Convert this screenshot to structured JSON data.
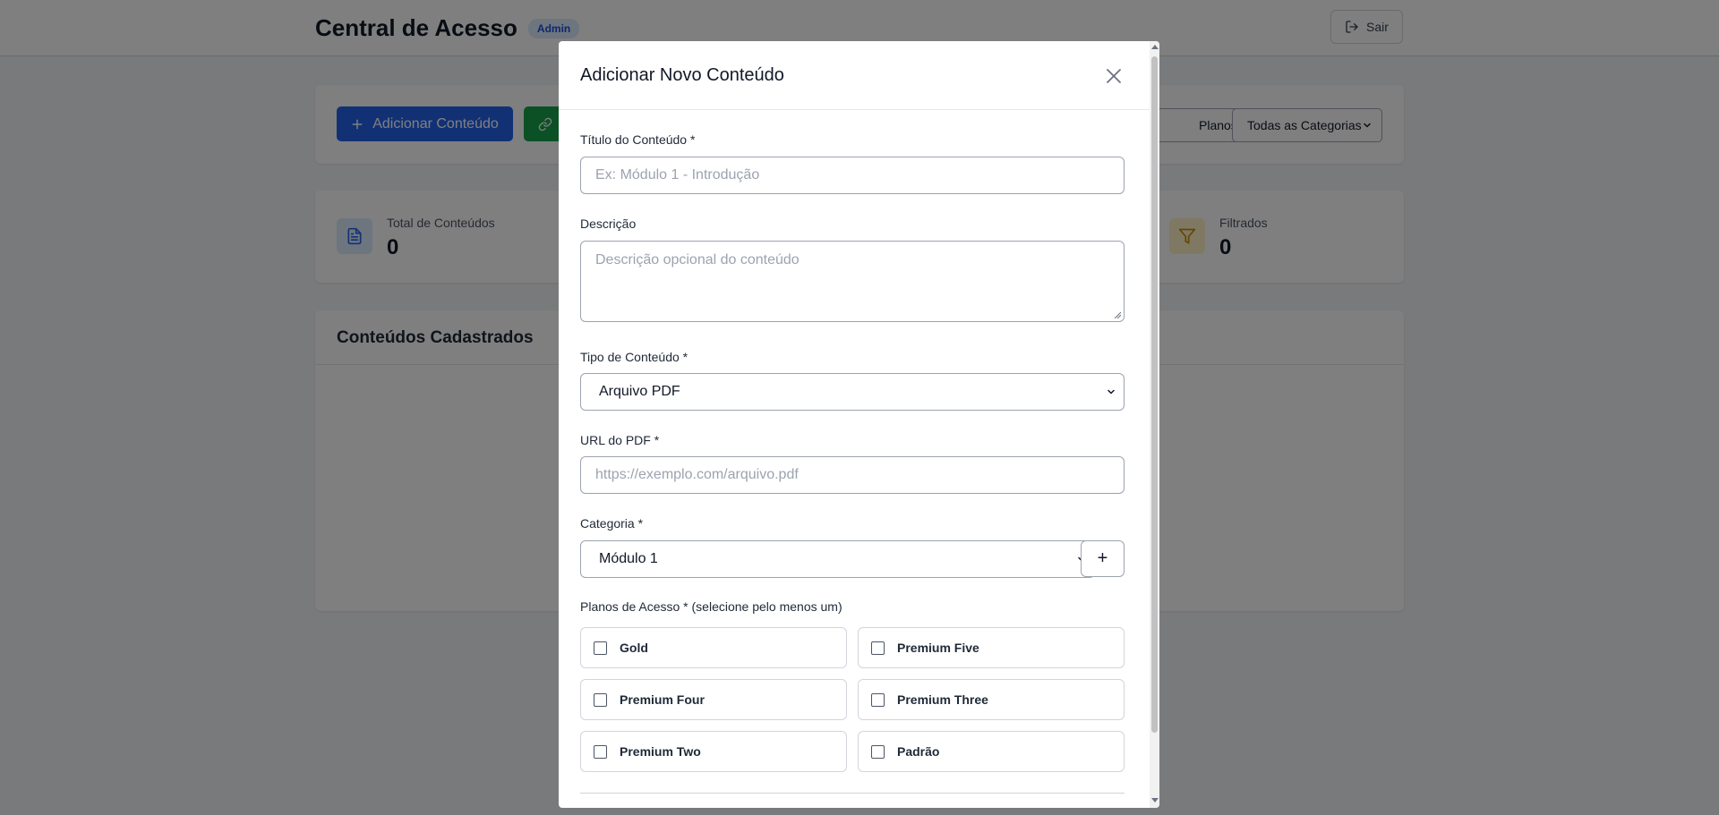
{
  "header": {
    "title": "Central de Acesso",
    "badge": "Admin",
    "logout_label": "Sair"
  },
  "toolbar": {
    "add_content_label": "Adicionar Conteúdo",
    "plans_filter_value": "Planos",
    "category_filter_value": "Todas as Categorias"
  },
  "stats": {
    "total": {
      "label": "Total de Conteúdos",
      "value": "0"
    },
    "filtered": {
      "label": "Filtrados",
      "value": "0"
    }
  },
  "list": {
    "title": "Conteúdos Cadastrados"
  },
  "modal": {
    "title": "Adicionar Novo Conteúdo",
    "title_field": {
      "label": "Título do Conteúdo *",
      "placeholder": "Ex: Módulo 1 - Introdução"
    },
    "description_field": {
      "label": "Descrição",
      "placeholder": "Descrição opcional do conteúdo"
    },
    "type_field": {
      "label": "Tipo de Conteúdo *",
      "value": "Arquivo PDF"
    },
    "url_field": {
      "label": "URL do PDF *",
      "placeholder": "https://exemplo.com/arquivo.pdf"
    },
    "category_field": {
      "label": "Categoria *",
      "value": "Módulo 1",
      "add_label": "+"
    },
    "plans": {
      "label": "Planos de Acesso * (selecione pelo menos um)",
      "items": [
        "Gold",
        "Premium Five",
        "Premium Four",
        "Premium Three",
        "Premium Two",
        "Padrão"
      ]
    }
  },
  "colors": {
    "primary": "#2563eb",
    "success": "#16a34a",
    "badge_bg": "#dbeafe",
    "overlay": "rgba(0,0,0,0.5)"
  },
  "icons": [
    "logout-icon",
    "plus-icon",
    "link-icon",
    "document-icon",
    "filter-icon",
    "close-icon",
    "chevron-down-icon"
  ]
}
